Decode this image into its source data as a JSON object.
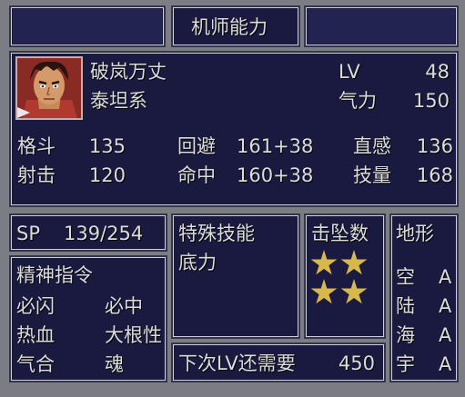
{
  "header": {
    "title": "机师能力"
  },
  "pilot": {
    "name": "破岚万丈",
    "series": "泰坦系",
    "lv_label": "LV",
    "lv": "48",
    "will_label": "气力",
    "will": "150"
  },
  "stats": {
    "melee_label": "格斗",
    "melee": "135",
    "shoot_label": "射击",
    "shoot": "120",
    "evade_label": "回避",
    "evade": "161+38",
    "hit_label": "命中",
    "hit": "160+38",
    "intuition_label": "直感",
    "intuition": "136",
    "skill_label": "技量",
    "skill": "168"
  },
  "sp": {
    "label": "SP",
    "value": "139/254"
  },
  "spirit": {
    "title": "精神指令",
    "commands": [
      "必闪",
      "必中",
      "热血",
      "大根性",
      "气合",
      "魂"
    ]
  },
  "special": {
    "title": "特殊技能",
    "items": [
      "底力"
    ]
  },
  "kills": {
    "title": "击坠数",
    "stars": 4
  },
  "terrain": {
    "title": "地形",
    "rows": [
      {
        "name": "空",
        "rank": "A"
      },
      {
        "name": "陆",
        "rank": "A"
      },
      {
        "name": "海",
        "rank": "A"
      },
      {
        "name": "宇",
        "rank": "A"
      }
    ]
  },
  "next_level": {
    "label": "下次LV还需要",
    "value": "450"
  },
  "colors": {
    "panel_bg": "#1a1a40",
    "text": "#dcdcdc",
    "star": "#d8b84a",
    "frame": "#7c7c84"
  }
}
